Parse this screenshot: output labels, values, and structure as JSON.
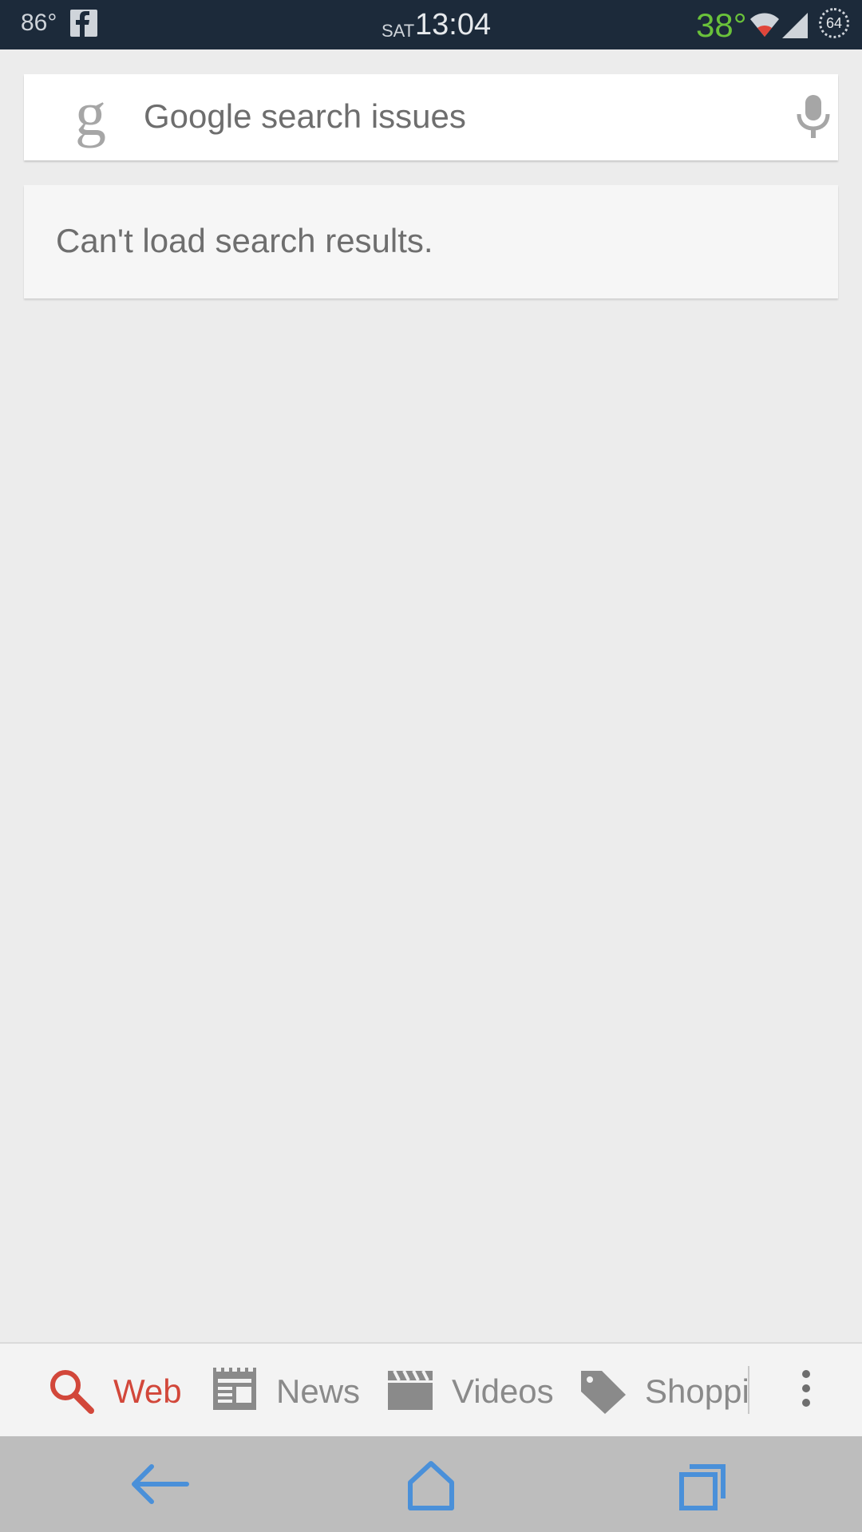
{
  "status_bar": {
    "temperature": "86°",
    "day": "SAT",
    "time": "13:04",
    "weather_temp": "38°",
    "battery": "64",
    "icons": [
      "facebook-icon",
      "wifi-icon",
      "signal-icon",
      "battery-icon"
    ],
    "colors": {
      "background": "#1c2a3a",
      "weather": "#6ac23a"
    }
  },
  "search": {
    "query": "Google search issues",
    "logo_letter": "g",
    "icons": [
      "google-g-icon",
      "microphone-icon"
    ]
  },
  "error": {
    "message": "Can't load search results."
  },
  "tabs": {
    "items": [
      {
        "label": "Web",
        "icon": "search-icon",
        "active": true
      },
      {
        "label": "News",
        "icon": "newspaper-icon",
        "active": false
      },
      {
        "label": "Videos",
        "icon": "clapperboard-icon",
        "active": false
      },
      {
        "label": "Shopping",
        "icon": "tag-icon",
        "active": false
      }
    ],
    "overflow_icon": "more-vert-icon",
    "colors": {
      "active": "#d2473a",
      "inactive": "#8a8a8a"
    }
  },
  "nav_bar": {
    "buttons": [
      "back-arrow-icon",
      "home-icon",
      "recent-apps-icon"
    ],
    "colors": {
      "icon": "#4a90d9",
      "background": "#bdbdbd"
    }
  }
}
